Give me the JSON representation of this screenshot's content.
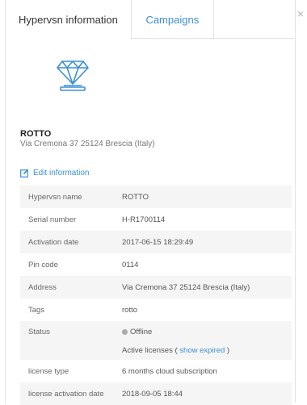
{
  "tabs": [
    {
      "label": "Hypervsn information",
      "active": true
    },
    {
      "label": "Campaigns",
      "active": false
    }
  ],
  "close_label": "×",
  "device": {
    "name": "ROTTO",
    "address": "Via Cremona 37 25124 Brescia (Italy)",
    "icon": "diamond-hologram-icon"
  },
  "edit_label": "Edit information",
  "details": {
    "hypervsn_name": {
      "label": "Hypervsn name",
      "value": "ROTTO"
    },
    "serial": {
      "label": "Serial number",
      "value": "H-R1700114"
    },
    "activation": {
      "label": "Activation date",
      "value": "2017-06-15 18:29:49"
    },
    "pin": {
      "label": "Pin code",
      "value": "0114"
    },
    "address": {
      "label": "Address",
      "value": "Via Cremona 37 25124 Brescia (Italy)"
    },
    "tags": {
      "label": "Tags",
      "value": "rotto"
    },
    "status": {
      "label": "Status",
      "value": "Offline",
      "licenses_prefix": "Active licenses (",
      "show_expired": "show expired",
      "licenses_suffix": ")"
    },
    "license_type": {
      "label": "license type",
      "value": "6 months cloud subscription"
    },
    "license_activation": {
      "label": "license activation date",
      "value": "2018-09-05 18:44"
    }
  },
  "colors": {
    "accent": "#3b8fd6",
    "offline": "#aaaaaa"
  }
}
